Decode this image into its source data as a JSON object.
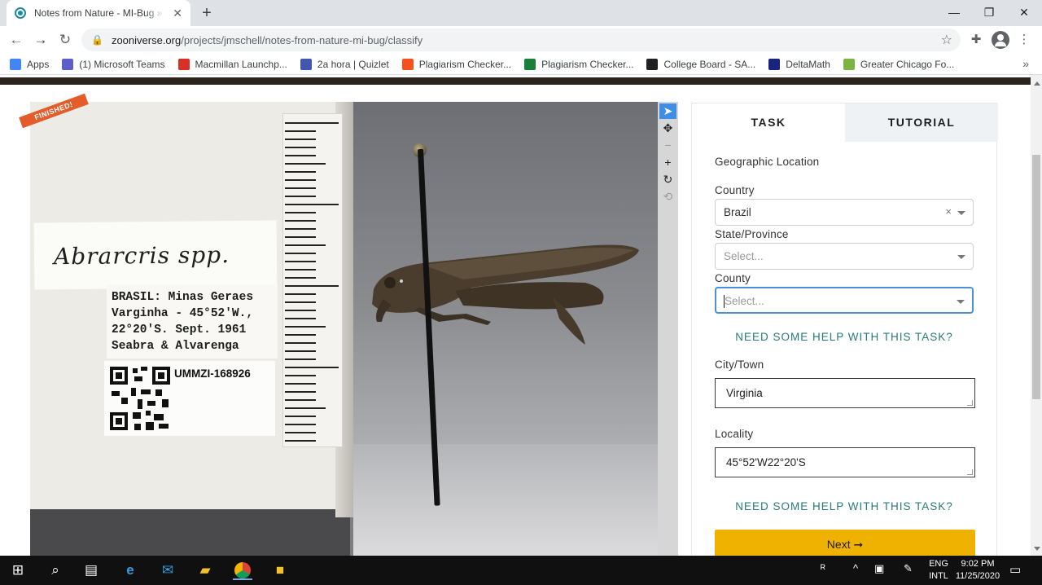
{
  "browser": {
    "tab_title": "Notes from Nature - MI-Bug » Cl",
    "tab_close": "✕",
    "new_tab": "+",
    "url_host": "zooniverse.org",
    "url_path": "/projects/jmschell/notes-from-nature-mi-bug/classify",
    "window_controls": {
      "minimize": "—",
      "maximize": "❐",
      "close": "✕"
    }
  },
  "bookmarks": [
    {
      "label": "Apps",
      "color": "#4285f4"
    },
    {
      "label": "(1) Microsoft Teams",
      "color": "#5b5fc7"
    },
    {
      "label": "Macmillan Launchp...",
      "color": "#d93025"
    },
    {
      "label": "2a hora | Quizlet",
      "color": "#4257b2"
    },
    {
      "label": "Plagiarism Checker...",
      "color": "#f4511e"
    },
    {
      "label": "Plagiarism Checker...",
      "color": "#188038"
    },
    {
      "label": "College Board - SA...",
      "color": "#202124"
    },
    {
      "label": "DeltaMath",
      "color": "#1a237e"
    },
    {
      "label": "Greater Chicago Fo...",
      "color": "#7cb342"
    }
  ],
  "bookmarks_more": "»",
  "subject": {
    "badge": "FINISHED!",
    "species_label": "Abrarcris spp.",
    "locality_lines": [
      "BRASIL: Minas Geraes",
      "Varginha - 45°52'W.,",
      "22°20'S.  Sept. 1961",
      "  Seabra & Alvarenga"
    ],
    "specimen_id": "UMMZI-168926"
  },
  "tools": {
    "pointer": "➤",
    "move": "✥",
    "zoom_out": "−",
    "zoom_in": "+",
    "rotate": "↻",
    "reset": "⟲"
  },
  "task_panel": {
    "tabs": {
      "task": "TASK",
      "tutorial": "TUTORIAL"
    },
    "section_title": "Geographic Location",
    "country": {
      "label": "Country",
      "value": "Brazil",
      "clear": "×"
    },
    "state": {
      "label": "State/Province",
      "placeholder": "Select..."
    },
    "county": {
      "label": "County",
      "placeholder": "Select..."
    },
    "help_text": "NEED SOME HELP WITH THIS TASK?",
    "city": {
      "label": "City/Town",
      "value": "Virginia"
    },
    "locality": {
      "label": "Locality",
      "value": "45°52'W22°20'S"
    },
    "next_button": "Next ➞"
  },
  "taskbar": {
    "lang_1": "ENG",
    "lang_2": "INTL",
    "time": "9:02 PM",
    "date": "11/25/2020"
  },
  "colors": {
    "accent_yellow": "#f0b200",
    "help_teal": "#277a7a",
    "badge_orange": "#e35c2a",
    "tool_active": "#3f8ee8"
  }
}
